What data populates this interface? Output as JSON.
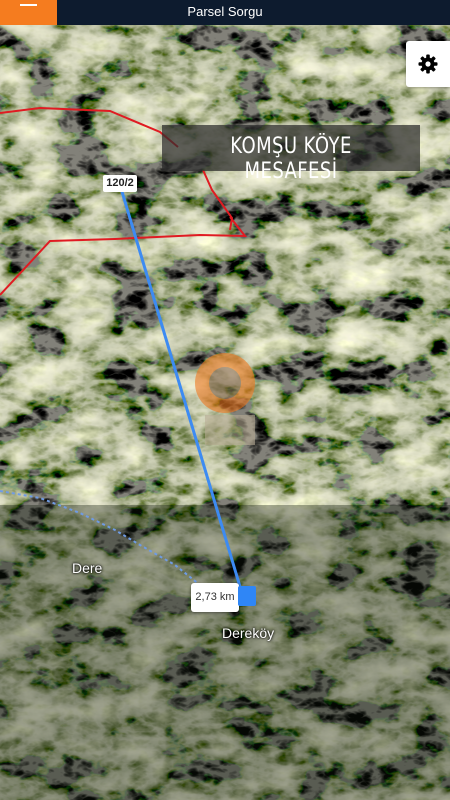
{
  "header": {
    "title": "Parsel Sorgu",
    "menu_icon": "hamburger-icon",
    "accent_color": "#f57c1f",
    "background_color": "#0d1b2e"
  },
  "map": {
    "view": "satellite",
    "banner_text": "KOMŞU KÖYE MESAFESİ",
    "parcel_label": "120/2",
    "distance_label": "2,73 km",
    "places": [
      "Dere",
      "Dereköy"
    ],
    "route_color": "#3d8bf2",
    "parcel_boundary_color": "#e01b22",
    "settings_icon": "gear-icon"
  }
}
